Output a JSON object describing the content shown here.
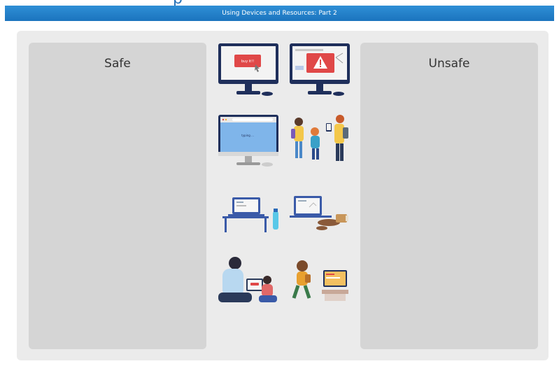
{
  "header": {
    "title": "Using Devices and Resources: Part 2"
  },
  "zones": {
    "safe_label": "Safe",
    "unsafe_label": "Unsafe"
  },
  "cards": {
    "ad_popup_text": "buy it!!",
    "browser_text": "typing ..."
  },
  "colors": {
    "header": "#2080c8",
    "stage": "#ebebeb",
    "zone": "#d5d5d5",
    "alert_red": "#e04848",
    "monitor": "#1f2f5b"
  }
}
